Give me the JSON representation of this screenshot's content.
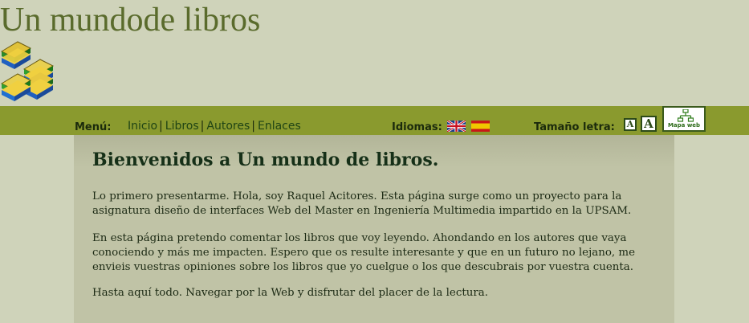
{
  "header": {
    "title": "Un mundode libros"
  },
  "nav": {
    "menu_label": "Menú:",
    "links": [
      "Inicio",
      "Libros",
      "Autores",
      "Enlaces"
    ],
    "languages_label": "Idiomas:",
    "font_size_label": "Tamaño letra:",
    "font_small": "A",
    "font_large": "A",
    "sitemap_label": "Mapa web"
  },
  "content": {
    "heading": "Bienvenidos a Un mundo de libros.",
    "paragraphs": [
      "Lo primero presentarme. Hola, soy Raquel Acitores. Esta página surge como un proyecto para la asignatura diseño de interfaces Web del Master en Ingeniería Multimedia impartido en la UPSAM.",
      "En esta página pretendo comentar los libros que voy leyendo. Ahondando en los autores que vaya conociendo y más me impacten. Espero que os resulte interesante y que en un futuro no lejano, me envieis vuestras opiniones sobre los libros que yo cuelgue o los que descubrais por vuestra cuenta.",
      "Hasta aquí todo. Navegar por la Web y disfrutar del placer de la lectura."
    ]
  },
  "colors": {
    "background": "#cfd3ba",
    "navbar": "#8a9a2e",
    "title": "#5a6b2c",
    "content_bg": "#c0c3a6"
  },
  "icons": [
    "books-logo-icon",
    "uk-flag-icon",
    "spain-flag-icon",
    "sitemap-icon"
  ]
}
